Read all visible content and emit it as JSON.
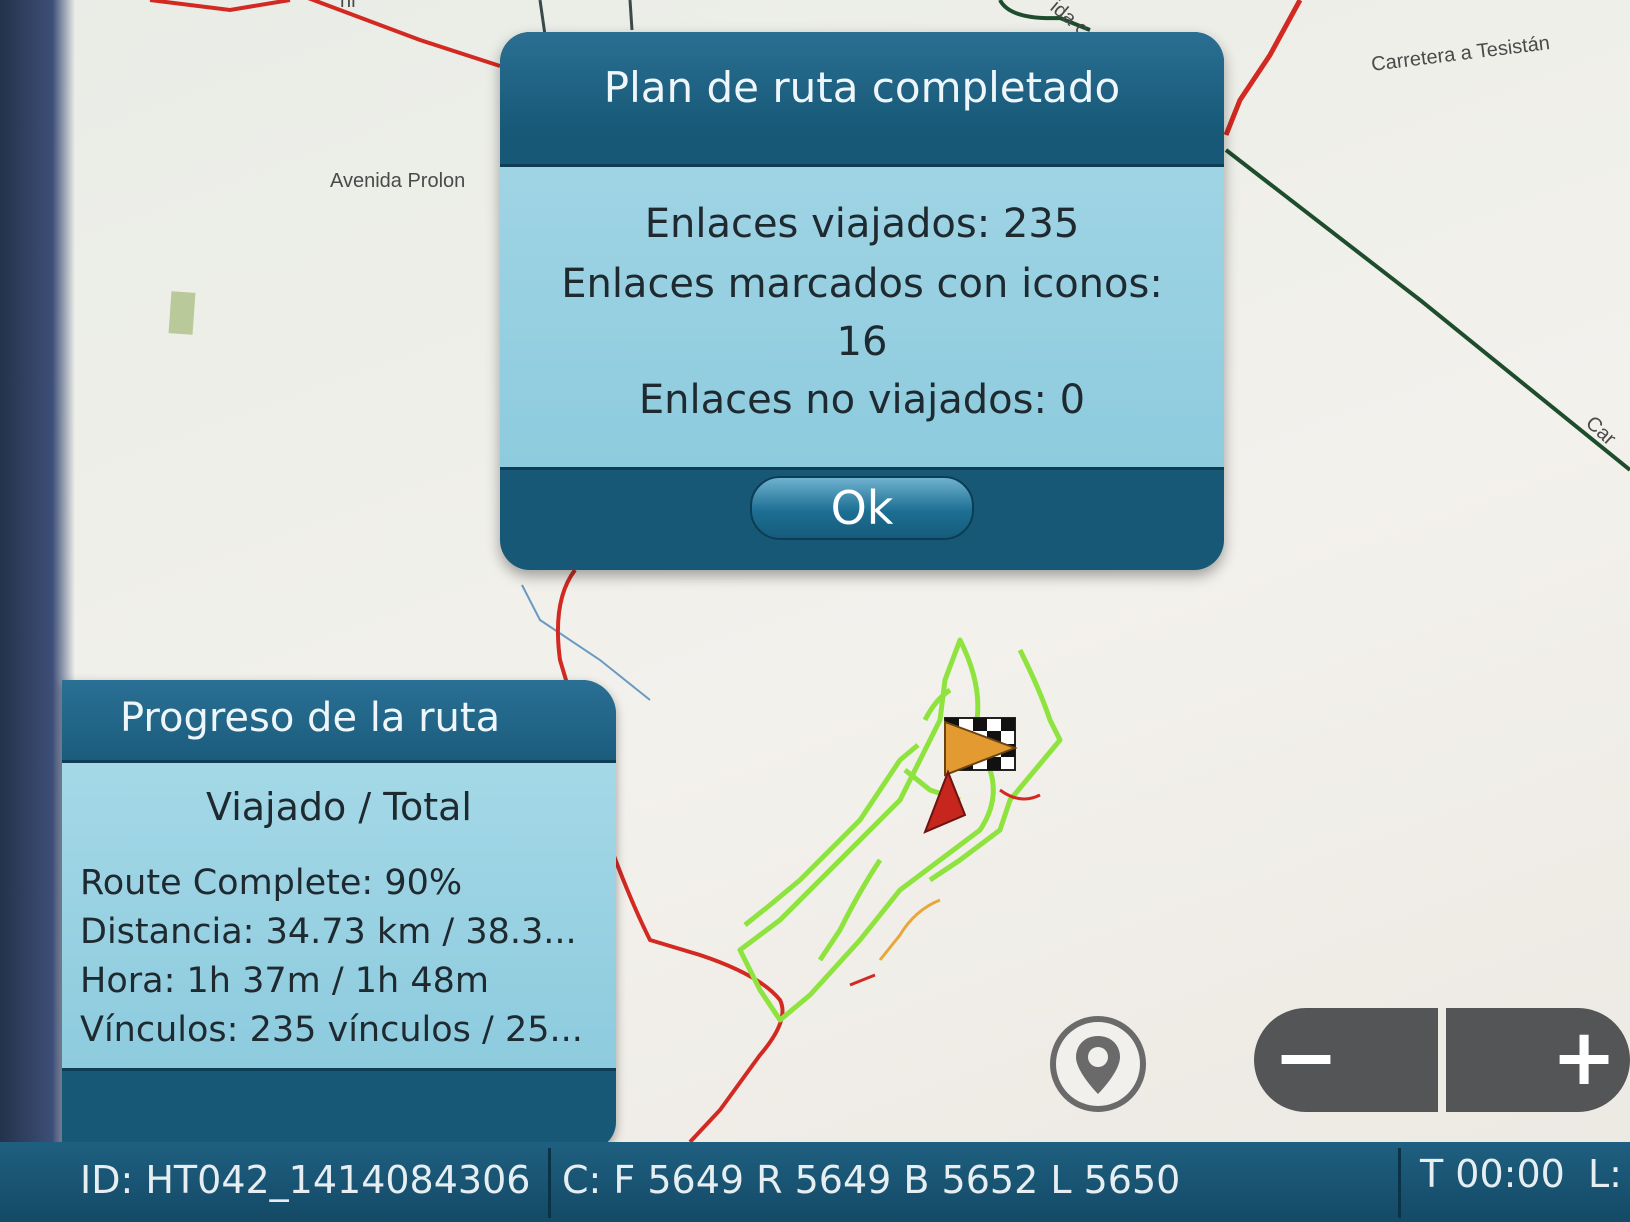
{
  "map": {
    "labels": {
      "avenida": "Avenida Prolon",
      "carretera": "Carretera a Tesistán",
      "car_partial": "Car",
      "top_partial_1": "nr",
      "top_partial_2": "ida c"
    },
    "colors": {
      "background": "#f1efe9",
      "road_red": "#d22a22",
      "road_green": "#1d4d2c",
      "trail_green": "#8ee33e",
      "trail_orange": "#e8a73a"
    }
  },
  "dialog": {
    "title": "Plan de ruta completado",
    "lines": [
      "Enlaces viajados: 235",
      "Enlaces marcados con iconos:",
      "16",
      "Enlaces no viajados: 0"
    ],
    "ok_label": "Ok"
  },
  "progress": {
    "title": "Progreso de la ruta",
    "subtitle": "Viajado / Total",
    "route_complete": "Route Complete: 90%",
    "distance": "Distancia: 34.73 km / 38.3...",
    "time": "Hora: 1h 37m / 1h 48m",
    "links": "Vínculos: 235 vínculos / 25..."
  },
  "controls": {
    "locate_icon": "location-pin-icon",
    "zoom_out_label": "−",
    "zoom_in_label": "+"
  },
  "status_bar": {
    "id": "ID: HT042_1414084306",
    "counts": "C: F 5649 R 5649 B 5652 L 5650",
    "time": "T 00:00",
    "l_partial": "L:"
  }
}
